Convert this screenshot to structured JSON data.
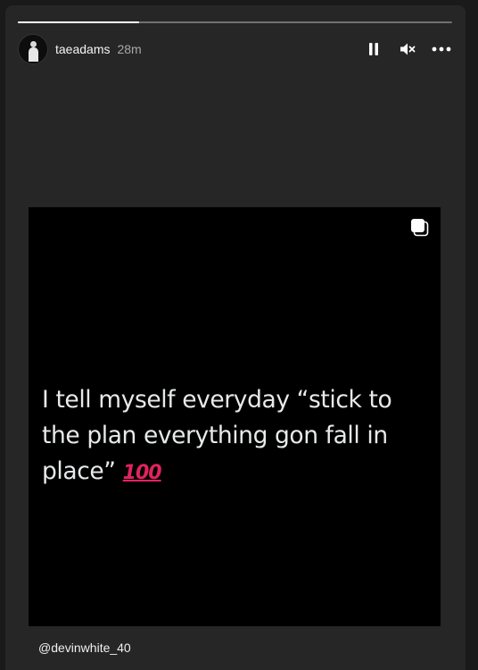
{
  "story": {
    "progress": 0.28,
    "username": "taeadams",
    "timestamp": "28m",
    "controls": {
      "pause_icon": "pause-icon",
      "mute_icon": "mute-icon",
      "more_icon": "more-options-icon"
    },
    "post": {
      "quote": "I tell myself everyday “stick to the plan everything gon fall in place”",
      "emoji": "100",
      "carousel_icon": "carousel-icon"
    },
    "mention": "@devinwhite_40"
  }
}
